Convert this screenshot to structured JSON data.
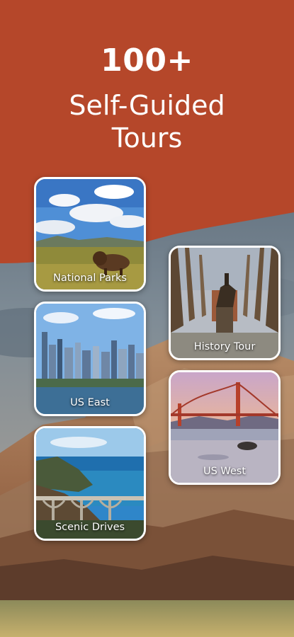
{
  "hero": {
    "count": "100+",
    "title_line1": "Self-Guided",
    "title_line2": "Tours"
  },
  "colors": {
    "brand_rust": "#B5472A",
    "text": "#FFFFFF"
  },
  "tours": [
    {
      "label": "National Parks",
      "image": "bison-in-meadow-photo"
    },
    {
      "label": "US East",
      "image": "city-skyline-photo"
    },
    {
      "label": "Scenic Drives",
      "image": "coastal-bridge-photo"
    },
    {
      "label": "History Tour",
      "image": "equestrian-statue-photo"
    },
    {
      "label": "US West",
      "image": "golden-gate-bridge-photo"
    }
  ]
}
